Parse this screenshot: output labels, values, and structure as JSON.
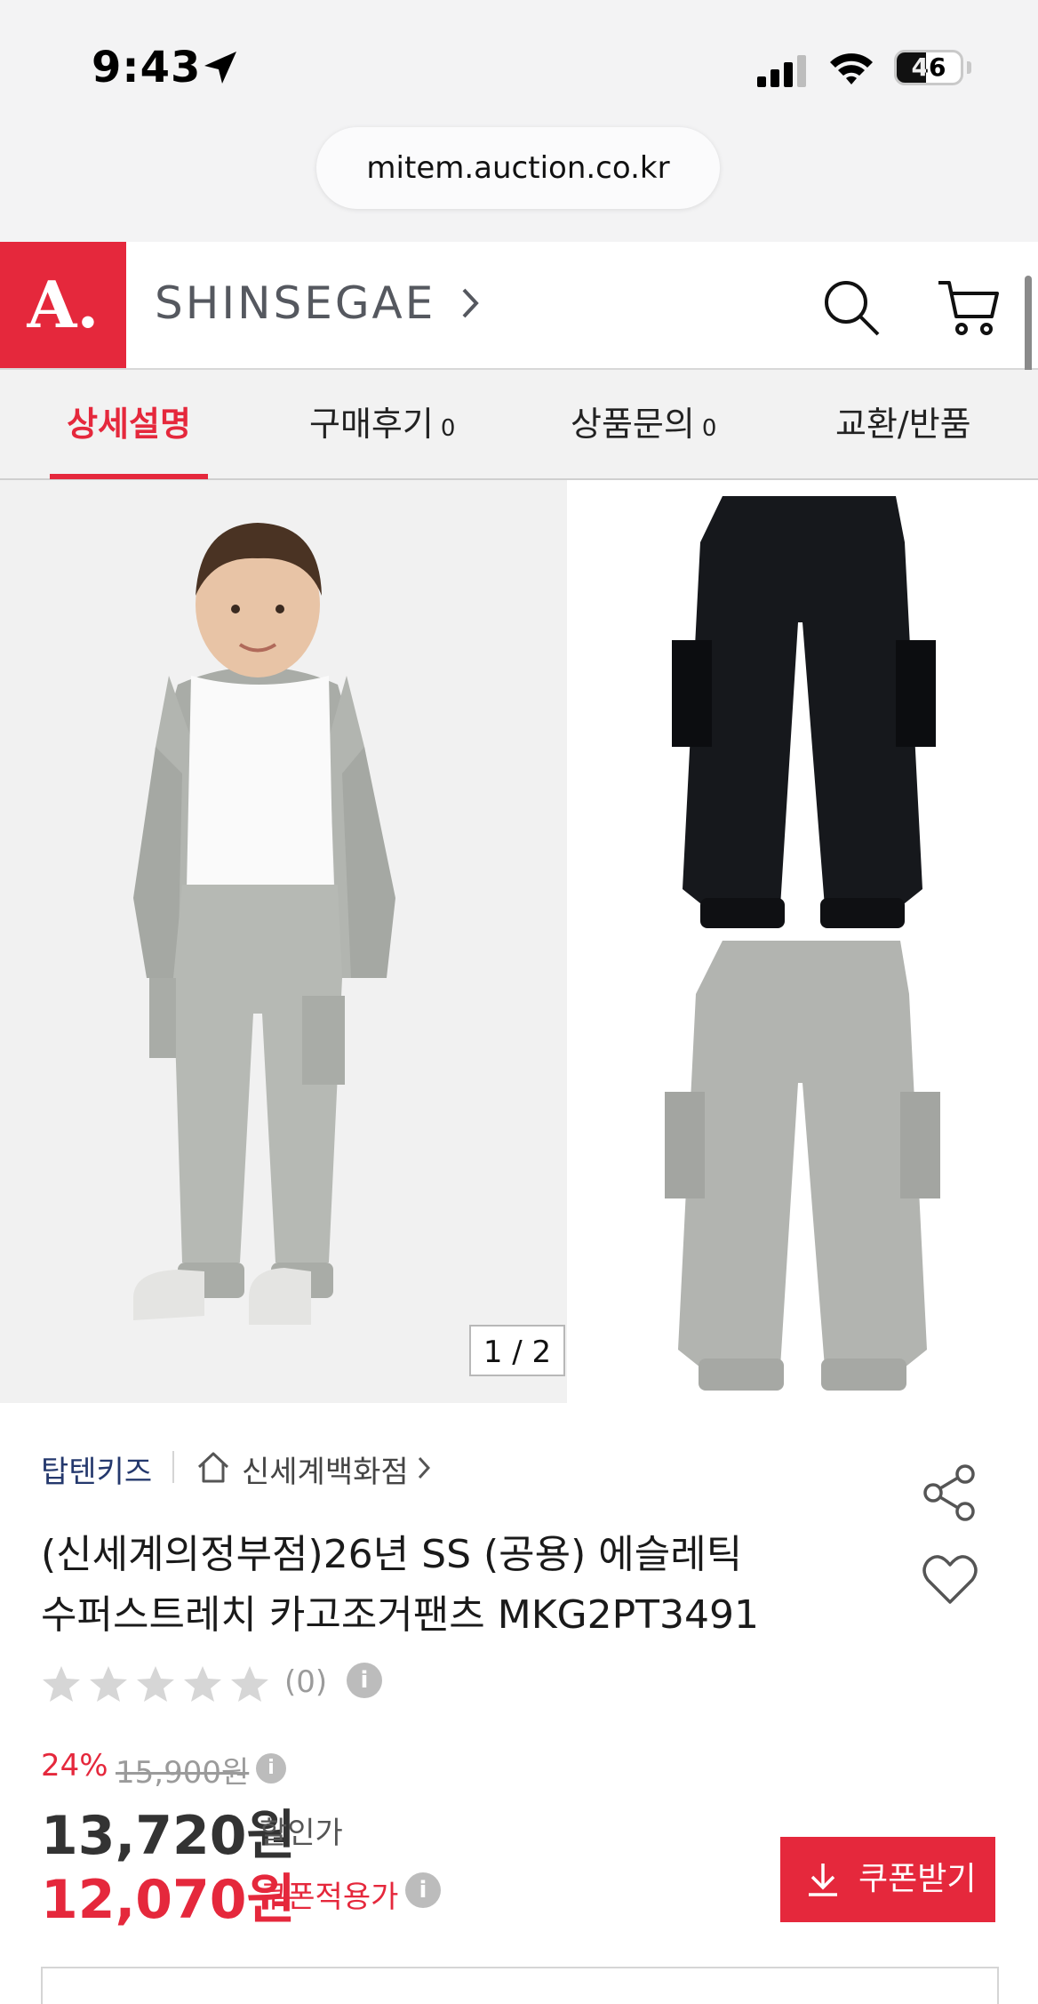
{
  "status_bar": {
    "time": "9:43",
    "battery_level": "46",
    "battery_fraction": 0.46
  },
  "browser": {
    "url": "mitem.auction.co.kr"
  },
  "header": {
    "logo": "A.",
    "brand": "SHINSEGAE",
    "brand_color": "#e5283c"
  },
  "tabs": [
    {
      "label": "상세설명",
      "count": ""
    },
    {
      "label": "구매후기",
      "count": "0"
    },
    {
      "label": "상품문의",
      "count": "0"
    },
    {
      "label": "교환/반품",
      "count": ""
    }
  ],
  "gallery": {
    "page_indicator": "1 / 2"
  },
  "product": {
    "brand": "탑텐키즈",
    "store": "신세계백화점",
    "title_line1": "(신세계의정부점)26년 SS (공용) 에슬레틱",
    "title_line2": "수퍼스트레치 카고조거팬츠 MKG2PT3491",
    "rating_stars": 0,
    "rating_count": "(0)"
  },
  "price": {
    "discount_rate": "24%",
    "original": "15,900원",
    "sale": "13,720원",
    "sale_label": "할인가",
    "coupon": "12,070원",
    "coupon_label": "쿠폰적용가",
    "coupon_button": "쿠폰받기"
  },
  "icons": {
    "info": "i"
  }
}
